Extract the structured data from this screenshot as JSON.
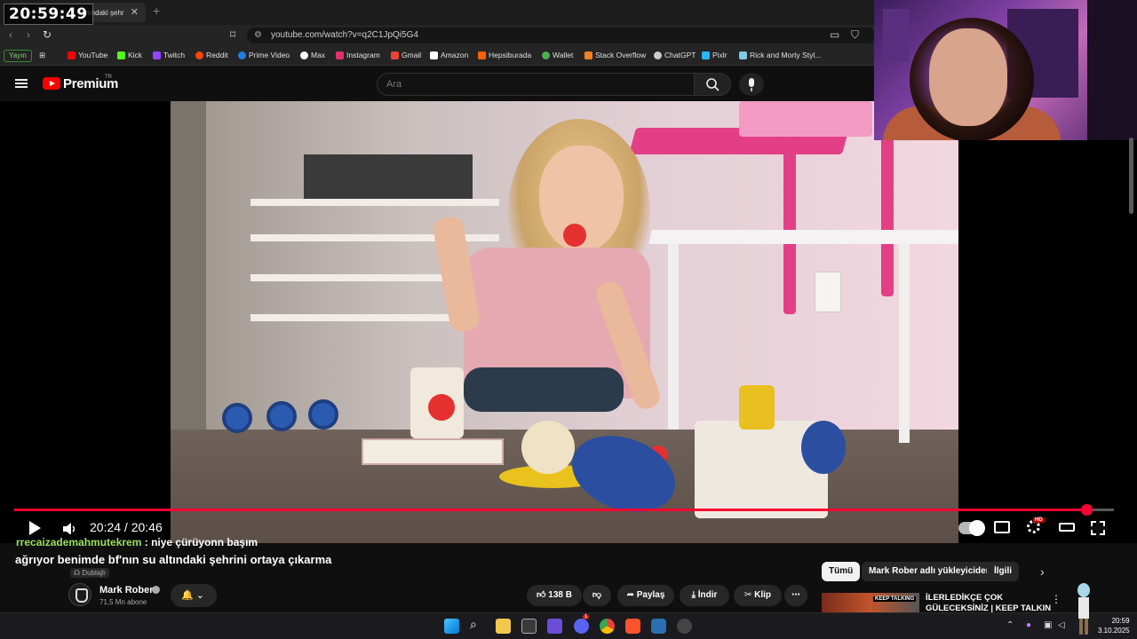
{
  "browser": {
    "tab_title_fragment": "altındaki şehr",
    "clock_overlay": "20:59:49",
    "url": "youtube.com/watch?v=q2C1JpQi5G4",
    "stream_badge": "Yayın",
    "bookmarks": [
      "YouTube",
      "Kick",
      "Twitch",
      "Reddit",
      "Prime Video",
      "Max",
      "Instagram",
      "Gmail",
      "Amazon",
      "Hepsiburada",
      "Wallet",
      "Stack Overflow",
      "ChatGPT",
      "Pixlr",
      "Rick and Morty Styl..."
    ]
  },
  "youtube": {
    "brand": "Premium",
    "brand_sup": "TR",
    "search_placeholder": "Ara"
  },
  "player": {
    "time_current": "20:24",
    "time_total": "20:46",
    "time_display": "20:24 / 20:46",
    "progress_fraction": 0.975
  },
  "chat": {
    "username": "rrecaizademahmutekrem",
    "message": " : niye çürüyonn başım"
  },
  "video": {
    "title_visible": "ağrıyor benimde bf'nın su altındaki şehrini ortaya çıkarma",
    "title_overlap": "ağrıyor ber",
    "title_overlay": "Mark Rober",
    "dubbed_label": "Dublajlı",
    "channel_name": "Mark Rober",
    "subscribers": "71,5 Mn abone",
    "likes": "138 B",
    "share_label": "Paylaş",
    "download_label": "İndir",
    "clip_label": "Klip"
  },
  "sidebar": {
    "chips": [
      "Tümü",
      "Mark Rober adlı yükleyiciden",
      "İlgili"
    ],
    "rec_title_line1": "İLERLEDİKÇE ÇOK",
    "rec_title_line2": "GÜLECEKSİNİZ | KEEP TALKIN",
    "rec_thumb_text": "KEEP TALKING"
  },
  "taskbar": {
    "time": "20:59",
    "date": "3.10.2025",
    "discord_badge": "1"
  },
  "colors": {
    "accent": "#ff0033",
    "chat_user": "#9be15d",
    "background": "#0f0f0f"
  }
}
